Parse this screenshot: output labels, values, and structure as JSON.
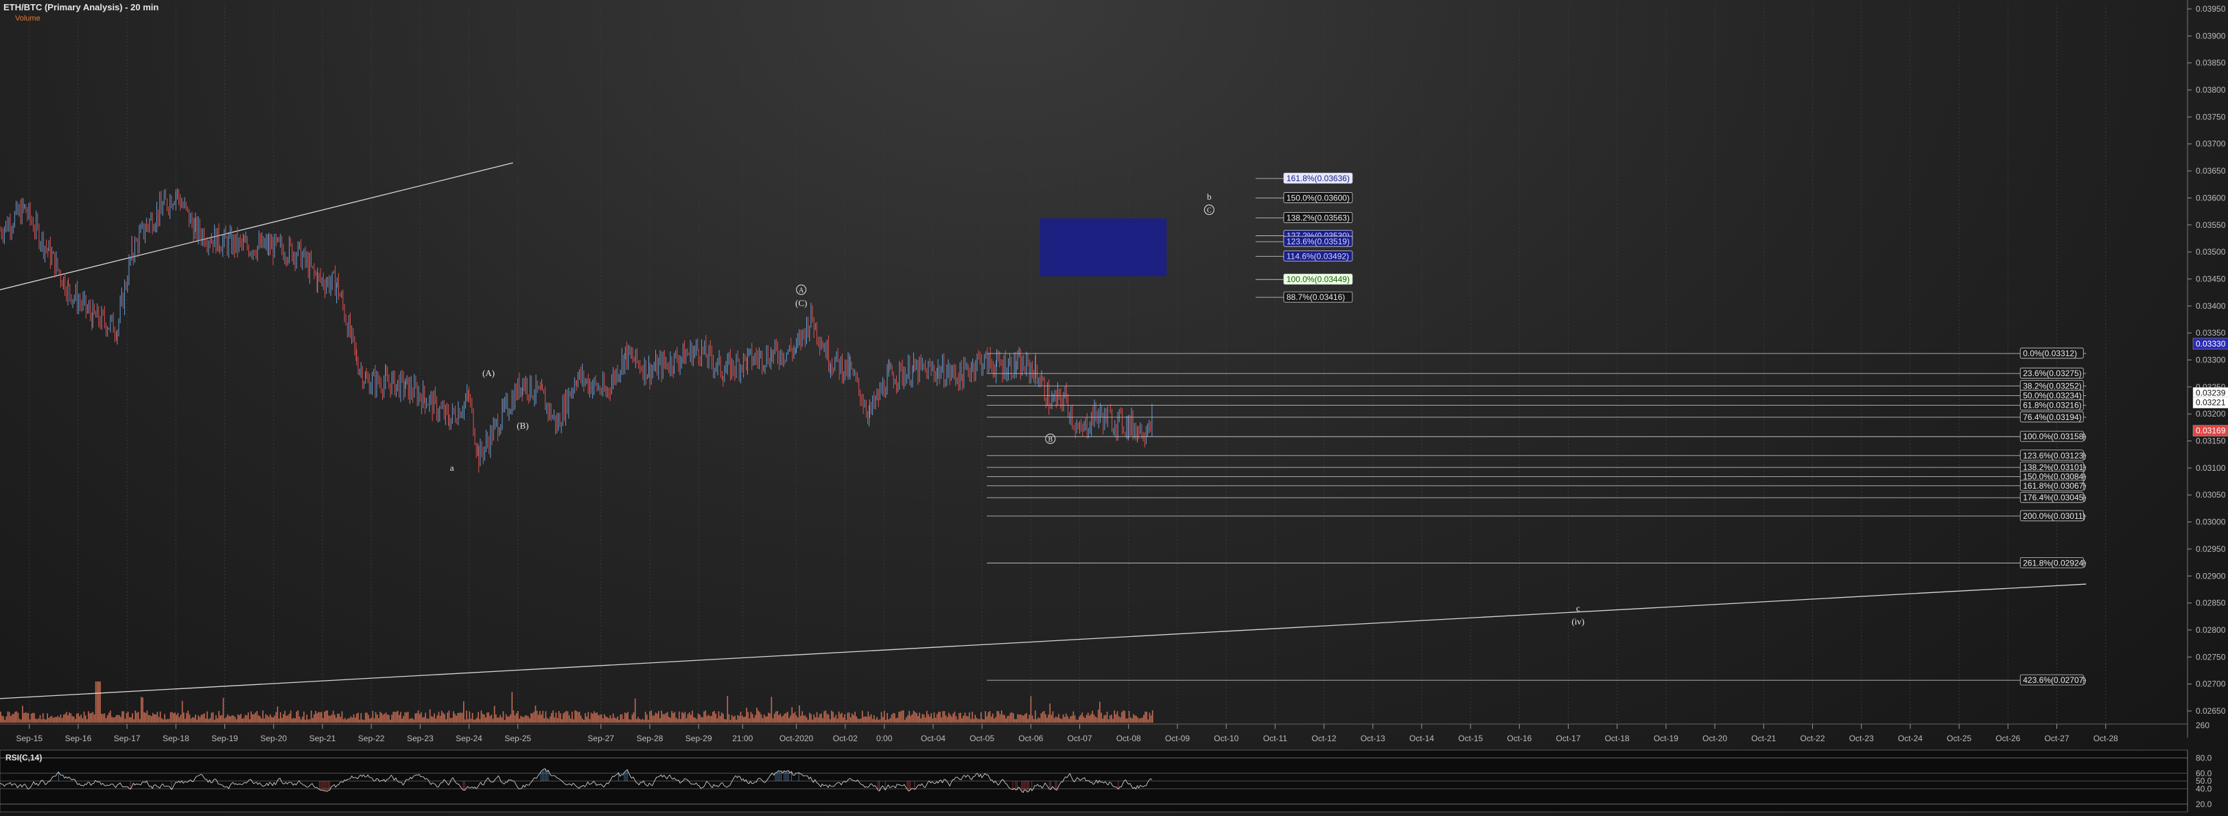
{
  "header": {
    "title": "ETH/BTC (Primary Analysis) - 20 min",
    "volume_label": "Volume"
  },
  "colors": {
    "up": "#6a9ed4",
    "down": "#e05050",
    "volume": "#e0795a",
    "target_box": "#1b1f8a",
    "price_tag": "#ffffff"
  },
  "chart_data": {
    "type": "candlestick",
    "title": "ETH/BTC (Primary Analysis) - 20 min",
    "ylim": [
      0.0262,
      0.0396
    ],
    "y_ticks": [
      "0.03950",
      "0.03900",
      "0.03850",
      "0.03800",
      "0.03750",
      "0.03700",
      "0.03650",
      "0.03600",
      "0.03550",
      "0.03500",
      "0.03450",
      "0.03400",
      "0.03350",
      "0.03300",
      "0.03250",
      "0.03200",
      "0.03150",
      "0.03100",
      "0.03050",
      "0.03000",
      "0.02950",
      "0.02900",
      "0.02850",
      "0.02800",
      "0.02750",
      "0.02700",
      "0.02650"
    ],
    "x_labels": [
      {
        "label": "Sep-15",
        "day": 0.6
      },
      {
        "label": "Sep-16",
        "day": 1.6
      },
      {
        "label": "Sep-17",
        "day": 2.6
      },
      {
        "label": "Sep-18",
        "day": 3.6
      },
      {
        "label": "Sep-19",
        "day": 4.6
      },
      {
        "label": "Sep-20",
        "day": 5.6
      },
      {
        "label": "Sep-21",
        "day": 6.6
      },
      {
        "label": "Sep-22",
        "day": 7.6
      },
      {
        "label": "Sep-23",
        "day": 8.6
      },
      {
        "label": "Sep-24",
        "day": 9.6
      },
      {
        "label": "Sep-25",
        "day": 10.6
      },
      {
        "label": "Sep-27",
        "day": 12.3
      },
      {
        "label": "Sep-28",
        "day": 13.3
      },
      {
        "label": "Sep-29",
        "day": 14.3
      },
      {
        "label": "21:00",
        "day": 15.2
      },
      {
        "label": "Oct-2020",
        "day": 16.3
      },
      {
        "label": "Oct-02",
        "day": 17.3
      },
      {
        "label": "0:00",
        "day": 18.1
      },
      {
        "label": "Oct-04",
        "day": 19.1
      },
      {
        "label": "Oct-05",
        "day": 20.1
      },
      {
        "label": "Oct-06",
        "day": 21.1
      },
      {
        "label": "Oct-07",
        "day": 22.1
      },
      {
        "label": "Oct-08",
        "day": 23.1
      },
      {
        "label": "Oct-09",
        "day": 24.1
      },
      {
        "label": "Oct-10",
        "day": 25.1
      },
      {
        "label": "Oct-11",
        "day": 26.1
      },
      {
        "label": "Oct-12",
        "day": 27.1
      },
      {
        "label": "Oct-13",
        "day": 28.1
      },
      {
        "label": "Oct-14",
        "day": 29.1
      },
      {
        "label": "Oct-15",
        "day": 30.1
      },
      {
        "label": "Oct-16",
        "day": 31.1
      },
      {
        "label": "Oct-17",
        "day": 32.1
      },
      {
        "label": "Oct-18",
        "day": 33.1
      },
      {
        "label": "Oct-19",
        "day": 34.1
      },
      {
        "label": "Oct-20",
        "day": 35.1
      },
      {
        "label": "Oct-21",
        "day": 36.1
      },
      {
        "label": "Oct-22",
        "day": 37.1
      },
      {
        "label": "Oct-23",
        "day": 38.1
      },
      {
        "label": "Oct-24",
        "day": 39.1
      },
      {
        "label": "Oct-25",
        "day": 40.1
      },
      {
        "label": "Oct-26",
        "day": 41.1
      },
      {
        "label": "Oct-27",
        "day": 42.1
      },
      {
        "label": "Oct-28",
        "day": 43.1
      }
    ],
    "price_path": [
      [
        0,
        0.0354
      ],
      [
        0.5,
        0.0358
      ],
      [
        1.0,
        0.035
      ],
      [
        1.4,
        0.0343
      ],
      [
        1.9,
        0.0338
      ],
      [
        2.4,
        0.0336
      ],
      [
        2.7,
        0.035
      ],
      [
        3.0,
        0.0355
      ],
      [
        3.3,
        0.0358
      ],
      [
        3.6,
        0.0361
      ],
      [
        4.0,
        0.0354
      ],
      [
        4.5,
        0.0352
      ],
      [
        5.0,
        0.0351
      ],
      [
        5.5,
        0.0351
      ],
      [
        6.1,
        0.035
      ],
      [
        6.5,
        0.0345
      ],
      [
        6.9,
        0.0344
      ],
      [
        7.3,
        0.033
      ],
      [
        7.5,
        0.0326
      ],
      [
        7.9,
        0.0326
      ],
      [
        8.3,
        0.0325
      ],
      [
        8.7,
        0.0323
      ],
      [
        9.2,
        0.0319
      ],
      [
        9.6,
        0.0323
      ],
      [
        9.8,
        0.0312
      ],
      [
        10.3,
        0.032
      ],
      [
        10.7,
        0.0326
      ],
      [
        11.1,
        0.0323
      ],
      [
        11.4,
        0.0318
      ],
      [
        11.8,
        0.0327
      ],
      [
        12.4,
        0.0324
      ],
      [
        12.8,
        0.0331
      ],
      [
        13.3,
        0.0328
      ],
      [
        13.8,
        0.033
      ],
      [
        14.3,
        0.0332
      ],
      [
        14.8,
        0.0328
      ],
      [
        15.3,
        0.033
      ],
      [
        15.8,
        0.0331
      ],
      [
        16.3,
        0.0332
      ],
      [
        16.6,
        0.0338
      ],
      [
        17.0,
        0.033
      ],
      [
        17.4,
        0.0328
      ],
      [
        17.8,
        0.032
      ],
      [
        18.2,
        0.0327
      ],
      [
        18.7,
        0.0328
      ],
      [
        19.2,
        0.0328
      ],
      [
        19.7,
        0.0327
      ],
      [
        20.0,
        0.033
      ],
      [
        20.4,
        0.0329
      ],
      [
        20.8,
        0.0329
      ],
      [
        21.2,
        0.0328
      ],
      [
        21.5,
        0.0322
      ],
      [
        21.8,
        0.0323
      ],
      [
        22.1,
        0.0316
      ],
      [
        22.4,
        0.032
      ],
      [
        22.7,
        0.0319
      ],
      [
        23.1,
        0.0318
      ],
      [
        23.4,
        0.0317
      ],
      [
        23.6,
        0.032
      ]
    ],
    "fib_retracement": [
      {
        "label": "0.0%(0.03312)",
        "price": 0.03312
      },
      {
        "label": "23.6%(0.03275)",
        "price": 0.03275
      },
      {
        "label": "38.2%(0.03252)",
        "price": 0.03252
      },
      {
        "label": "50.0%(0.03234)",
        "price": 0.03234
      },
      {
        "label": "61.8%(0.03216)",
        "price": 0.03216
      },
      {
        "label": "76.4%(0.03194)",
        "price": 0.03194
      },
      {
        "label": "100.0%(0.03158)",
        "price": 0.03158
      },
      {
        "label": "123.6%(0.03123)",
        "price": 0.03123
      },
      {
        "label": "138.2%(0.03101)",
        "price": 0.03101
      },
      {
        "label": "150.0%(0.03084)",
        "price": 0.03084
      },
      {
        "label": "161.8%(0.03067)",
        "price": 0.03067
      },
      {
        "label": "176.4%(0.03045)",
        "price": 0.03045
      },
      {
        "label": "200.0%(0.03011)",
        "price": 0.03011
      },
      {
        "label": "261.8%(0.02924)",
        "price": 0.02924
      },
      {
        "label": "423.6%(0.02707)",
        "price": 0.02707
      }
    ],
    "fib_extension": [
      {
        "label": "161.8%(0.03636)",
        "price": 0.03636,
        "style": "highlight"
      },
      {
        "label": "150.0%(0.03600)",
        "price": 0.036,
        "style": "plain"
      },
      {
        "label": "138.2%(0.03563)",
        "price": 0.03563,
        "style": "plain"
      },
      {
        "label": "127.2%(0.03530)",
        "price": 0.0353,
        "style": "box"
      },
      {
        "label": "123.6%(0.03519)",
        "price": 0.03519,
        "style": "box"
      },
      {
        "label": "114.6%(0.03492)",
        "price": 0.03492,
        "style": "box"
      },
      {
        "label": "100.0%(0.03449)",
        "price": 0.03449,
        "style": "green"
      },
      {
        "label": "88.7%(0.03416)",
        "price": 0.03416,
        "style": "plain"
      }
    ],
    "target_box": {
      "day_start": 21.0,
      "day_end": 24.3,
      "price_low": 0.03455,
      "price_high": 0.03562
    },
    "price_tags": [
      {
        "label": "0.03330",
        "price": 0.0333,
        "color": "#2a2ab5"
      },
      {
        "label": "0.03239",
        "price": 0.03239,
        "color": "#ffffff"
      },
      {
        "label": "0.03221",
        "price": 0.03221,
        "color": "#ffffff"
      },
      {
        "label": "0.03169",
        "price": 0.03169,
        "color": "#e04545"
      }
    ],
    "wave_labels": [
      {
        "label": "a",
        "day": 9.25,
        "price": 0.03095
      },
      {
        "label": "(A)",
        "day": 10.0,
        "price": 0.0327
      },
      {
        "label": "(B)",
        "day": 10.7,
        "price": 0.03173
      },
      {
        "label": "(C)",
        "day": 16.4,
        "price": 0.034
      },
      {
        "label": "A",
        "day": 16.4,
        "price": 0.03425,
        "circled": true
      },
      {
        "label": "B",
        "day": 21.5,
        "price": 0.03149,
        "circled": true
      },
      {
        "label": "b",
        "day": 24.75,
        "price": 0.03597
      },
      {
        "label": "C",
        "day": 24.75,
        "price": 0.03573,
        "circled": true
      },
      {
        "label": "c",
        "day": 32.3,
        "price": 0.02835
      },
      {
        "label": "(iv)",
        "day": 32.3,
        "price": 0.0281
      }
    ],
    "trendlines": [
      {
        "d1": 0,
        "p1": 0.0343,
        "d2": 10.5,
        "p2": 0.03665
      },
      {
        "d1": 0,
        "p1": 0.02673,
        "d2": 42.7,
        "p2": 0.02885
      }
    ],
    "volume_axis_label": "260",
    "rsi": {
      "label": "RSI(C,14)",
      "ticks": [
        "80.0",
        "60.0",
        "50.0",
        "40.0",
        "20.0"
      ]
    }
  }
}
